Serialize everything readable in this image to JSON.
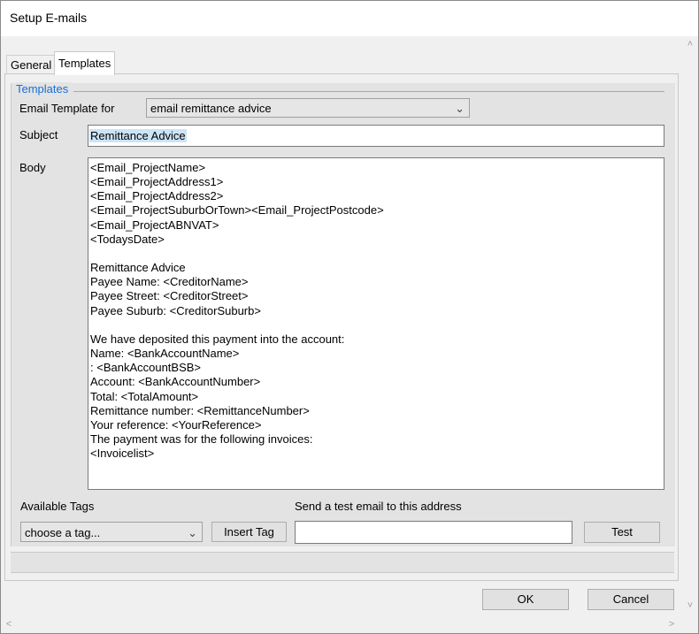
{
  "window": {
    "title": "Setup E-mails"
  },
  "tabs": [
    {
      "label": "General"
    },
    {
      "label": "Templates"
    }
  ],
  "templates": {
    "group_title": "Templates",
    "email_template_label": "Email Template for",
    "email_template_value": "email remittance advice",
    "subject_label": "Subject",
    "subject_value": "Remittance Advice",
    "body_label": "Body",
    "body_lines": [
      "<Email_ProjectName>",
      "<Email_ProjectAddress1>",
      "<Email_ProjectAddress2>",
      "<Email_ProjectSuburbOrTown><Email_ProjectPostcode>",
      "<Email_ProjectABNVAT>",
      "<TodaysDate>",
      "",
      "Remittance Advice",
      "Payee Name: <CreditorName>",
      "Payee Street: <CreditorStreet>",
      "Payee Suburb: <CreditorSuburb>",
      "",
      "We have deposited this payment into the account:",
      "Name: <BankAccountName>",
      ": <BankAccountBSB>",
      "Account: <BankAccountNumber>",
      "Total: <TotalAmount>",
      "Remittance number: <RemittanceNumber>",
      "Your reference: <YourReference>",
      "The payment was for the following invoices:",
      "<Invoicelist>"
    ],
    "available_tags_label": "Available Tags",
    "tag_select_value": "choose a tag...",
    "insert_tag_label": "Insert Tag",
    "test_email_label": "Send a test email to this address",
    "test_email_value": "",
    "test_button_label": "Test"
  },
  "footer": {
    "ok_label": "OK",
    "cancel_label": "Cancel"
  },
  "icons": {
    "dropdown": "chevron-down-icon",
    "scroll_up": "chevron-up-icon",
    "scroll_down": "chevron-down-icon",
    "scroll_left": "chevron-left-icon",
    "scroll_right": "chevron-right-icon"
  },
  "colors": {
    "group_title": "#1a6fd8",
    "selection": "#cce4f7"
  }
}
